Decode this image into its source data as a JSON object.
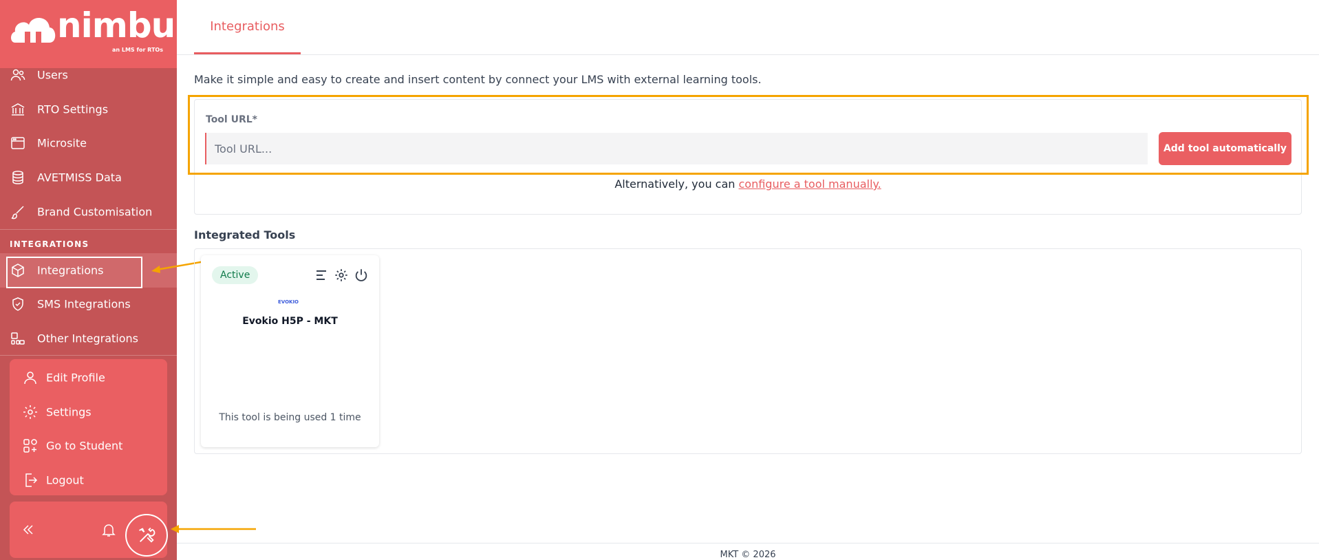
{
  "brand": {
    "name": "nimbu",
    "tagline": "an LMS for RTOs"
  },
  "sidebar": {
    "items": [
      {
        "label": "Users",
        "icon": "users-icon"
      },
      {
        "label": "RTO Settings",
        "icon": "bank-icon"
      },
      {
        "label": "Microsite",
        "icon": "browser-icon"
      },
      {
        "label": "AVETMISS Data",
        "icon": "database-icon"
      },
      {
        "label": "Brand Customisation",
        "icon": "brush-icon"
      }
    ],
    "section_integrations": "INTEGRATIONS",
    "integration_items": [
      {
        "label": "Integrations",
        "icon": "cube-icon"
      },
      {
        "label": "SMS Integrations",
        "icon": "shield-check-icon"
      },
      {
        "label": "Other Integrations",
        "icon": "widgets-icon"
      }
    ],
    "profile_items": [
      {
        "label": "Edit Profile",
        "icon": "user-icon"
      },
      {
        "label": "Settings",
        "icon": "gear-icon"
      },
      {
        "label": "Go to Student",
        "icon": "apps-icon"
      },
      {
        "label": "Logout",
        "icon": "logout-icon"
      }
    ]
  },
  "tabs": [
    {
      "label": "Integrations"
    }
  ],
  "main": {
    "intro": "Make it simple and easy to create and insert content by connect your LMS with external learning tools.",
    "url_label": "Tool URL*",
    "url_placeholder": "Tool URL...",
    "add_button": "Add tool automatically",
    "alt_prefix": "Alternatively, you can",
    "alt_link": "configure a tool manually.",
    "integrated_title": "Integrated Tools",
    "tools": [
      {
        "status": "Active",
        "logo_text": "EVOKIO",
        "name": "Evokio H5P - MKT",
        "usage": "This tool is being used 1 time"
      }
    ]
  },
  "footer": {
    "text": "MKT © 2026"
  },
  "colors": {
    "accent": "#ea5f62",
    "sidebar": "#c45456",
    "highlight": "#f5a400"
  }
}
